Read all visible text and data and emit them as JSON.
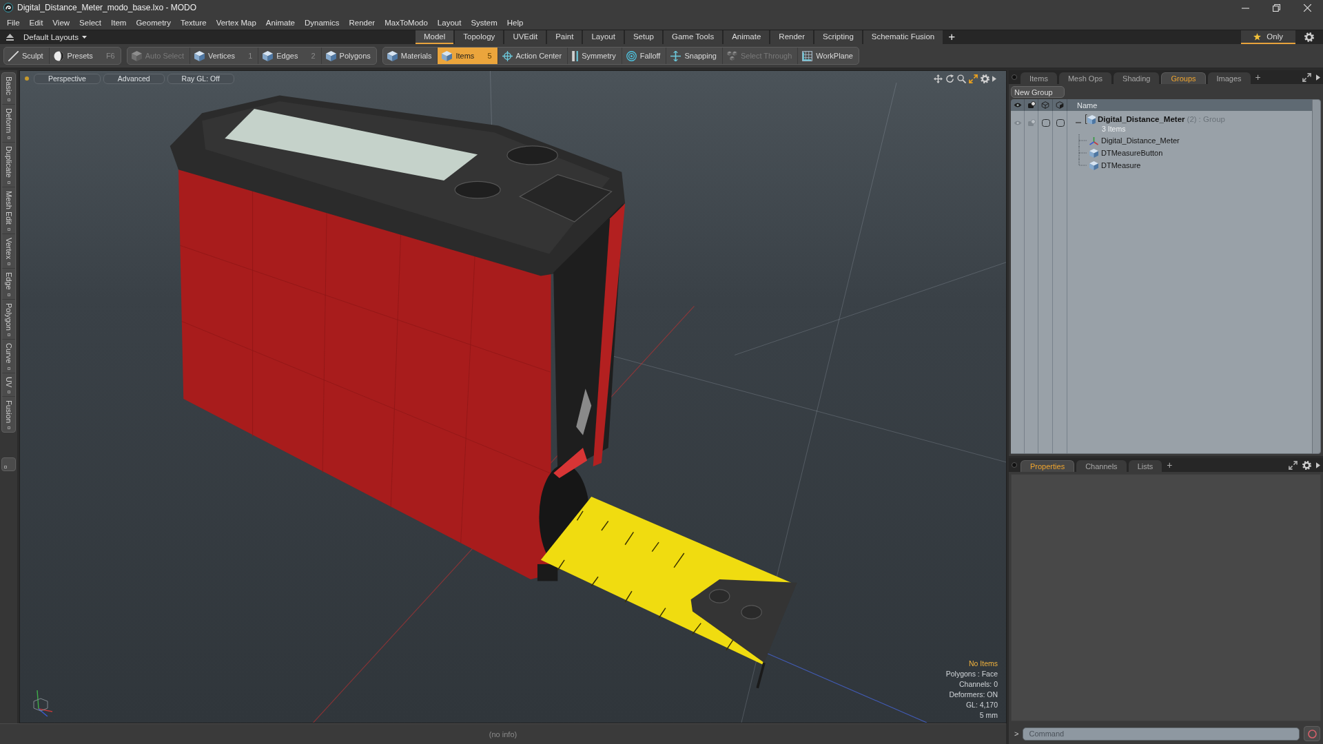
{
  "window": {
    "title": "Digital_Distance_Meter_modo_base.lxo - MODO"
  },
  "menu": [
    "File",
    "Edit",
    "View",
    "Select",
    "Item",
    "Geometry",
    "Texture",
    "Vertex Map",
    "Animate",
    "Dynamics",
    "Render",
    "MaxToModo",
    "Layout",
    "System",
    "Help"
  ],
  "layout_bar": {
    "layouts": "Default Layouts",
    "tabs": [
      {
        "label": "Model",
        "selected": true
      },
      {
        "label": "Topology",
        "selected": false
      },
      {
        "label": "UVEdit",
        "selected": false
      },
      {
        "label": "Paint",
        "selected": false
      },
      {
        "label": "Layout",
        "selected": false
      },
      {
        "label": "Setup",
        "selected": false
      },
      {
        "label": "Game Tools",
        "selected": false
      },
      {
        "label": "Animate",
        "selected": false
      },
      {
        "label": "Render",
        "selected": false
      },
      {
        "label": "Scripting",
        "selected": false
      },
      {
        "label": "Schematic Fusion",
        "selected": false
      }
    ],
    "add": "+",
    "only": {
      "label": "Only",
      "on": true
    }
  },
  "toolbar": [
    {
      "items": [
        {
          "label": "Sculpt",
          "kind": "brush",
          "selected": false,
          "disabled": false
        },
        {
          "label": "Presets",
          "shortcut": "F6",
          "kind": "sphere",
          "selected": false,
          "disabled": false
        }
      ]
    },
    {
      "items": [
        {
          "label": "Auto Select",
          "kind": "cube",
          "selected": false,
          "disabled": true
        },
        {
          "label": "Vertices",
          "shortcut": "1",
          "kind": "cube",
          "selected": false,
          "disabled": false
        },
        {
          "label": "Edges",
          "shortcut": "2",
          "kind": "cube",
          "selected": false,
          "disabled": false
        },
        {
          "label": "Polygons",
          "kind": "cube",
          "selected": false,
          "disabled": false
        }
      ]
    },
    {
      "items": [
        {
          "label": "Materials",
          "kind": "cube",
          "selected": false,
          "disabled": false
        },
        {
          "label": "Items",
          "shortcut": "5",
          "kind": "cube",
          "selected": true,
          "disabled": false
        },
        {
          "label": "Action Center",
          "kind": "crosshair",
          "selected": false,
          "disabled": false
        },
        {
          "label": "Symmetry",
          "kind": "bar",
          "selected": false,
          "disabled": false
        },
        {
          "label": "Falloff",
          "kind": "rings",
          "selected": false,
          "disabled": false
        },
        {
          "label": "Snapping",
          "kind": "plus",
          "selected": false,
          "disabled": false
        },
        {
          "label": "Select Through",
          "kind": "cubes",
          "selected": false,
          "disabled": true
        },
        {
          "label": "WorkPlane",
          "kind": "grid",
          "selected": false,
          "disabled": false
        }
      ]
    }
  ],
  "side_tabs": [
    "Basic",
    "Deform",
    "Duplicate",
    "Mesh Edit",
    "Vertex",
    "Edge",
    "Polygon",
    "Curve",
    "UV",
    "Fusion"
  ],
  "viewport": {
    "buttons": [
      "Perspective",
      "Advanced",
      "Ray GL: Off"
    ],
    "info": [
      {
        "text": "No Items",
        "kind": "highlight"
      },
      {
        "text": "Polygons : Face",
        "kind": "plain"
      },
      {
        "text": "Channels: 0",
        "kind": "plain"
      },
      {
        "text": "Deformers: ON",
        "kind": "plain"
      },
      {
        "text": "GL: 4,170",
        "kind": "plain"
      },
      {
        "text": "5 mm",
        "kind": "plain"
      }
    ]
  },
  "items_panel": {
    "tabs": [
      {
        "label": "Items",
        "selected": false
      },
      {
        "label": "Mesh Ops",
        "selected": false
      },
      {
        "label": "Shading",
        "selected": false
      },
      {
        "label": "Groups",
        "selected": true
      },
      {
        "label": "Images",
        "selected": false
      }
    ],
    "add": "+",
    "new_group": "New Group",
    "name_column": "Name",
    "groups": [
      {
        "name": "Digital_Distance_Meter",
        "count": "(2)",
        "type": ": Group",
        "summary": "3 Items",
        "expanded": true,
        "children": [
          {
            "name": "Digital_Distance_Meter",
            "kind": "locator"
          },
          {
            "name": "DTMeasureButton",
            "kind": "mesh"
          },
          {
            "name": "DTMeasure",
            "kind": "mesh"
          }
        ]
      }
    ]
  },
  "properties_panel": {
    "tabs": [
      {
        "label": "Properties",
        "selected": true
      },
      {
        "label": "Channels",
        "selected": false
      },
      {
        "label": "Lists",
        "selected": false
      }
    ],
    "add": "+"
  },
  "status_bar": {
    "text": "(no info)"
  },
  "command": {
    "prompt": ">",
    "placeholder": "Command"
  }
}
